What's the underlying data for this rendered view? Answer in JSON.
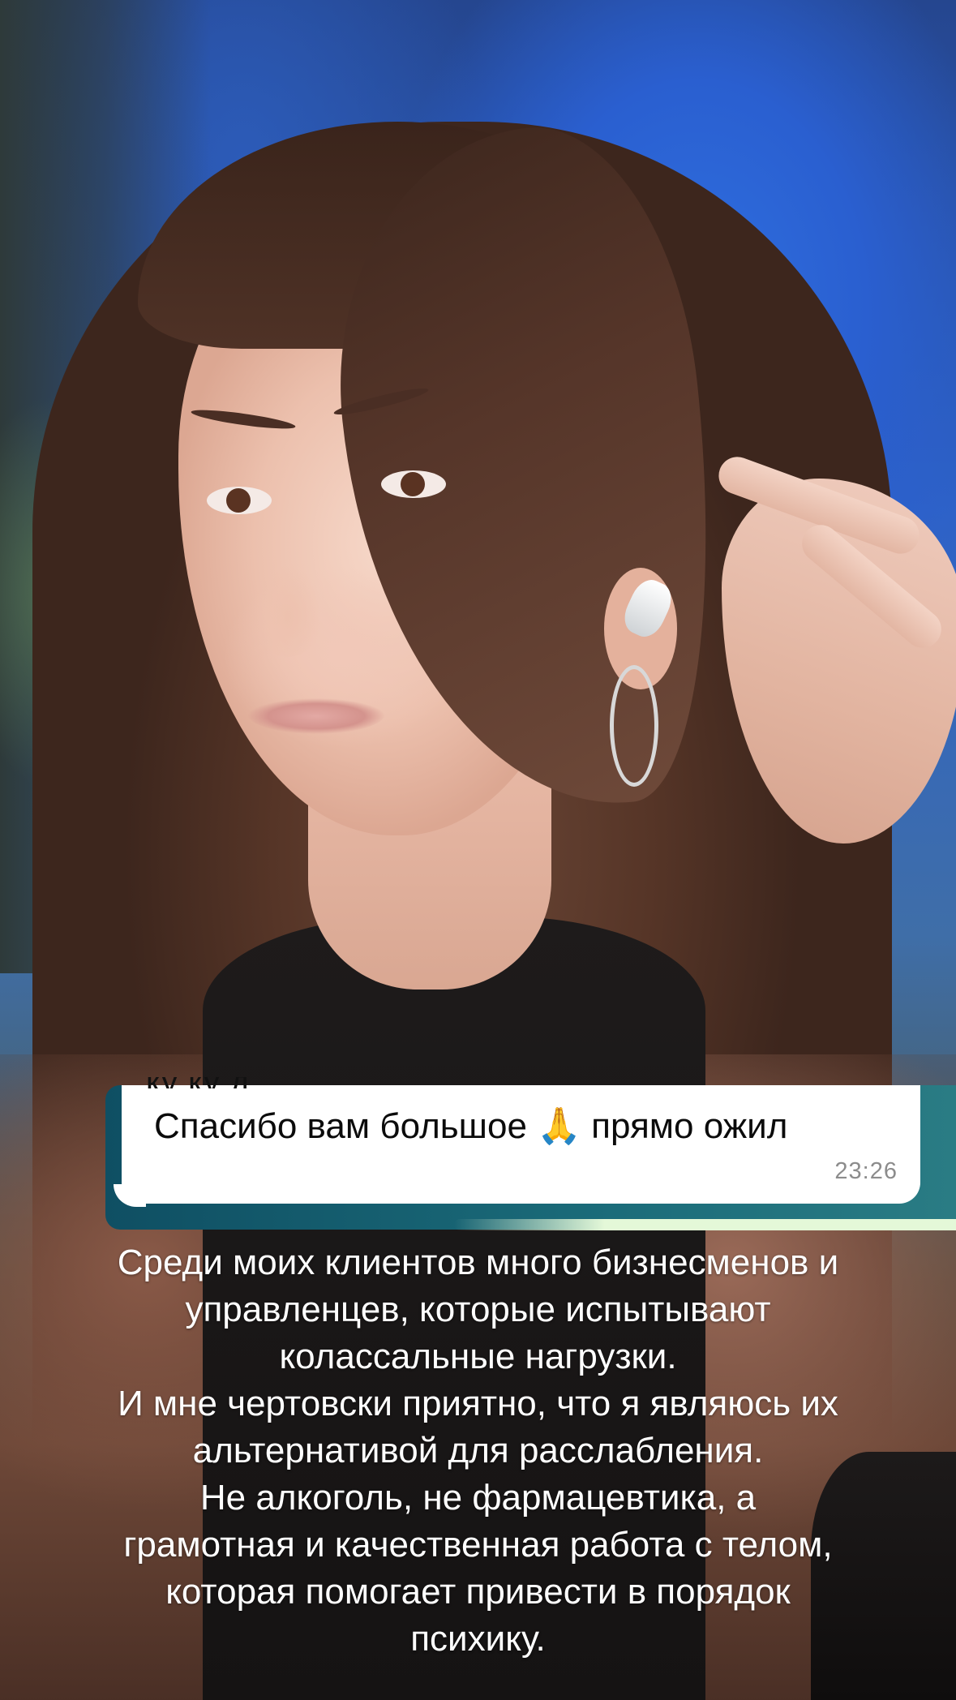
{
  "chat": {
    "message": "Спасибо вам большое 🙏 прямо ожил",
    "time": "23:26",
    "partial_text": "ку ку д"
  },
  "caption": {
    "lines": [
      "Среди моих клиентов много бизнесменов и",
      "управленцев, которые испытывают",
      "колассальные нагрузки.",
      "И мне чертовски приятно, что я являюсь их",
      "альтернативой для расслабления.",
      "Не алкоголь, не фармацевтика, а",
      "грамотная и качественная работа с телом,",
      "которая помогает привести в порядок",
      "психику."
    ]
  },
  "colors": {
    "chat_strip": "#1b6c7a",
    "bubble": "#ffffff",
    "caption_text": "#ffffff"
  }
}
